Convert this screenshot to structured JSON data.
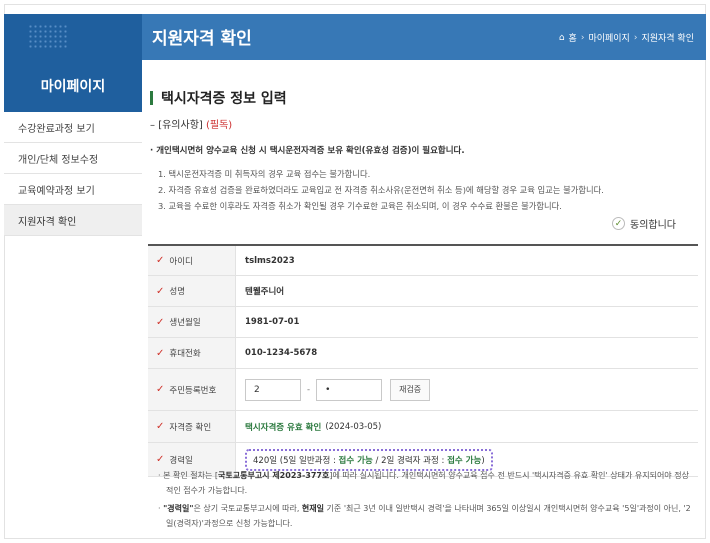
{
  "sidebar": {
    "title": "마이페이지",
    "items": [
      {
        "label": "수강완료과정 보기"
      },
      {
        "label": "개인/단체 정보수정"
      },
      {
        "label": "교육예약과정 보기"
      },
      {
        "label": "지원자격 확인"
      }
    ]
  },
  "header": {
    "title": "지원자격 확인",
    "breadcrumb": [
      "홈",
      "마이페이지",
      "지원자격 확인"
    ]
  },
  "section": {
    "title": "택시자격증 정보 입력",
    "notice_label": "[유의사항]",
    "notice_required": "(필독)",
    "notice_main": "개인택시면허 양수교육 신청 시 택시운전자격증 보유 확인(유효성 검증)이 필요합니다.",
    "notice_list": [
      "1. 택시운전자격증 미 취득자의 경우 교육 접수는 불가합니다.",
      "2. 자격증 유효성 검증을 완료하였더라도 교육입교 전 자격증 취소사유(운전면허 취소 등)에 해당할 경우 교육 입교는 불가합니다.",
      "3. 교육을 수료한 이후라도 자격증 취소가 확인될 경우 기수료한 교육은 취소되며, 이 경우 수수료 환불은 불가합니다."
    ],
    "agree_label": "동의합니다"
  },
  "form": {
    "rows": [
      {
        "label": "아이디",
        "value": "tslms2023"
      },
      {
        "label": "성명",
        "value": "텐웰주니어"
      },
      {
        "label": "생년월일",
        "value": "1981-07-01"
      },
      {
        "label": "휴대전화",
        "value": "010-1234-5678"
      }
    ],
    "rrn": {
      "label": "주민등록번호",
      "first": "2",
      "dash": "-",
      "second": "•",
      "button": "재검증"
    },
    "cert": {
      "label": "자격증 확인",
      "status": "택시자격증 유효 확인",
      "date": "(2024-03-05)"
    },
    "career": {
      "label": "경력일",
      "days": "420일",
      "part1": "(5일 일반과정 : ",
      "status1": "접수 가능",
      "part2": " / 2일 경력자 과정 : ",
      "status2": "접수 가능",
      "part3": ")"
    }
  },
  "footnotes": {
    "n1_a": "본 확인 절차는 [",
    "n1_b": "국토교통부고시 제2023-377호",
    "n1_c": "]에 따라 실시됩니다. 개인택시면허 양수교육 접수 전 반드시 '택시자격증 유효 확인' 상태가 유지되어야 정상적인 접수가 가능합니다.",
    "n2_a": "\"경력일\"",
    "n2_b": "은 상기 국토교통부고시에 따라, ",
    "n2_c": "현재일",
    "n2_d": " 기준 '최근 3년 이내 일반택시 경력'을 나타내며 365일 이상일시 개인택시면허 양수교육 '5일'과정이 아닌, '2일(경력자)'과정으로 신청 가능합니다."
  }
}
